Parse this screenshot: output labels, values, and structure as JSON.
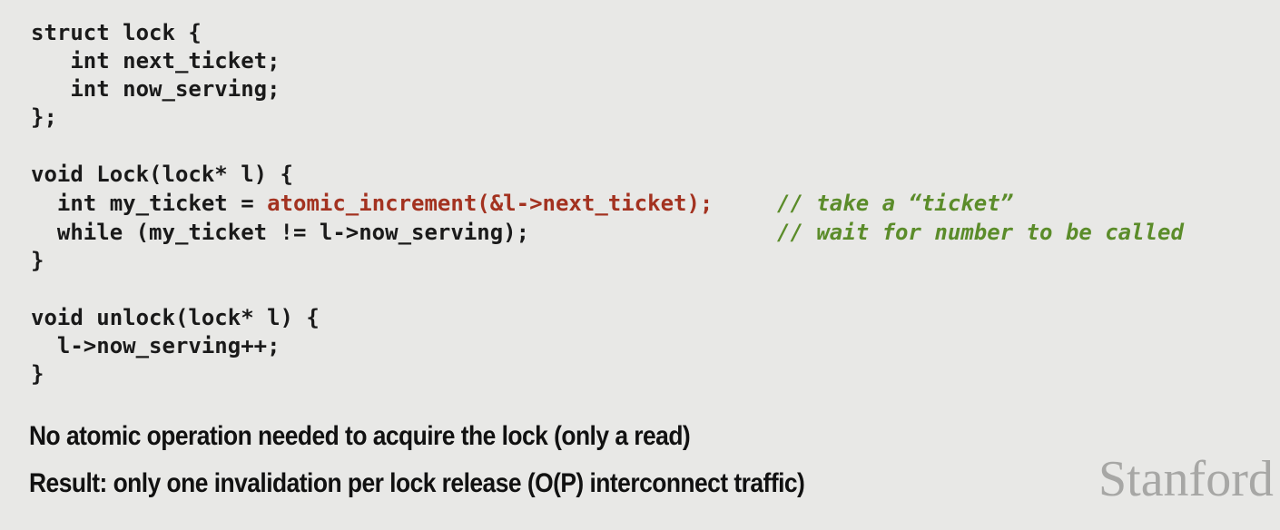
{
  "code": {
    "l1": "struct lock {",
    "l2": "   int next_ticket;",
    "l3": "   int now_serving;",
    "l4": "};",
    "l5": "void Lock(lock* l) {",
    "l6_pre": "  int my_ticket = ",
    "l6_hl": "atomic_increment(&l->next_ticket);",
    "l6_cmt": "// take a “ticket”",
    "l7": "  while (my_ticket != l->now_serving);",
    "l7_cmt": "// wait for number to be called",
    "l8": "}",
    "l9": "void unlock(lock* l) {",
    "l10": "  l->now_serving++;",
    "l11": "}"
  },
  "bullets": {
    "b1": "No atomic operation needed to acquire the lock (only a read)",
    "b2": "Result: only one invalidation per lock release (O(P) interconnect traffic)"
  },
  "logo": "Stanford",
  "colors": {
    "background": "#e8e8e6",
    "code_text": "#1a1a1a",
    "highlight": "#a33220",
    "comment": "#5b8c2a",
    "logo": "#a7a7a5"
  }
}
